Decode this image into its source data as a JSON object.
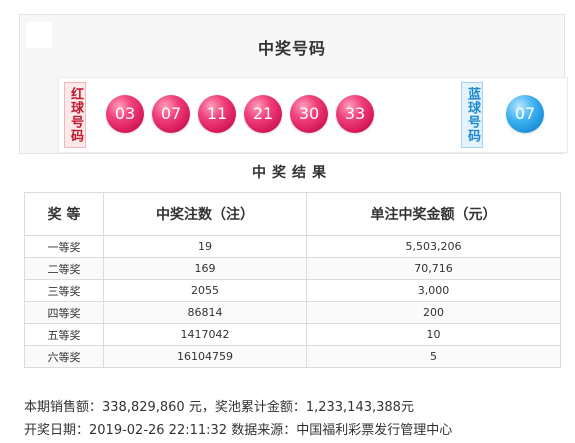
{
  "panel_title": "中奖号码",
  "red_label": "红球号码",
  "blue_label": "蓝球号码",
  "red_balls": [
    "03",
    "07",
    "11",
    "21",
    "30",
    "33"
  ],
  "blue_balls": [
    "07"
  ],
  "result_title": "中奖结果",
  "table": {
    "headers": [
      "奖 等",
      "中奖注数（注）",
      "单注中奖金额（元）"
    ],
    "rows": [
      {
        "prize": "一等奖",
        "count": "19",
        "amount": "5,503,206"
      },
      {
        "prize": "二等奖",
        "count": "169",
        "amount": "70,716"
      },
      {
        "prize": "三等奖",
        "count": "2055",
        "amount": "3,000"
      },
      {
        "prize": "四等奖",
        "count": "86814",
        "amount": "200"
      },
      {
        "prize": "五等奖",
        "count": "1417042",
        "amount": "10"
      },
      {
        "prize": "六等奖",
        "count": "16104759",
        "amount": "5"
      }
    ]
  },
  "footer": {
    "sales": "本期销售额：338,829,860 元，奖池累计金额：1,233,143,388元",
    "draw": "开奖日期：2019-02-26 22:11:32 数据来源：中国福利彩票发行管理中心"
  },
  "colors": {
    "red_accent": "#d31554",
    "blue_accent": "#168bd6",
    "corner": "#d2283c"
  }
}
